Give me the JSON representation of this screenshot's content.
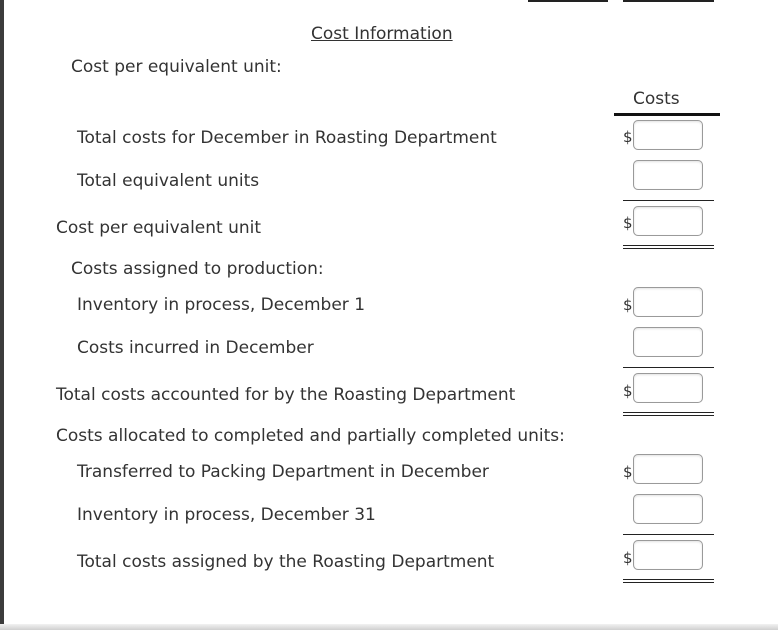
{
  "title": "Cost Information",
  "section_cost_per_unit": "Cost per equivalent unit:",
  "column_header": "Costs",
  "currency_symbol": "$",
  "rows": {
    "total_costs_december": "Total costs for December in Roasting Department",
    "total_equivalent_units": "Total equivalent units",
    "cost_per_equivalent_unit": "Cost per equivalent unit",
    "costs_assigned_header": "Costs assigned to production:",
    "inventory_dec1": "Inventory in process, December 1",
    "costs_incurred": "Costs incurred in December",
    "total_accounted": "Total costs accounted for by the Roasting Department",
    "costs_allocated_header": "Costs allocated to completed and partially completed units:",
    "transferred_packing": "Transferred to Packing Department in December",
    "inventory_dec31": "Inventory in process, December 31",
    "total_assigned": "Total costs assigned by the Roasting Department"
  },
  "inputs": {
    "total_costs_december": "",
    "total_equivalent_units": "",
    "cost_per_equivalent_unit": "",
    "inventory_dec1": "",
    "costs_incurred": "",
    "total_accounted": "",
    "transferred_packing": "",
    "inventory_dec31": "",
    "total_assigned": ""
  }
}
